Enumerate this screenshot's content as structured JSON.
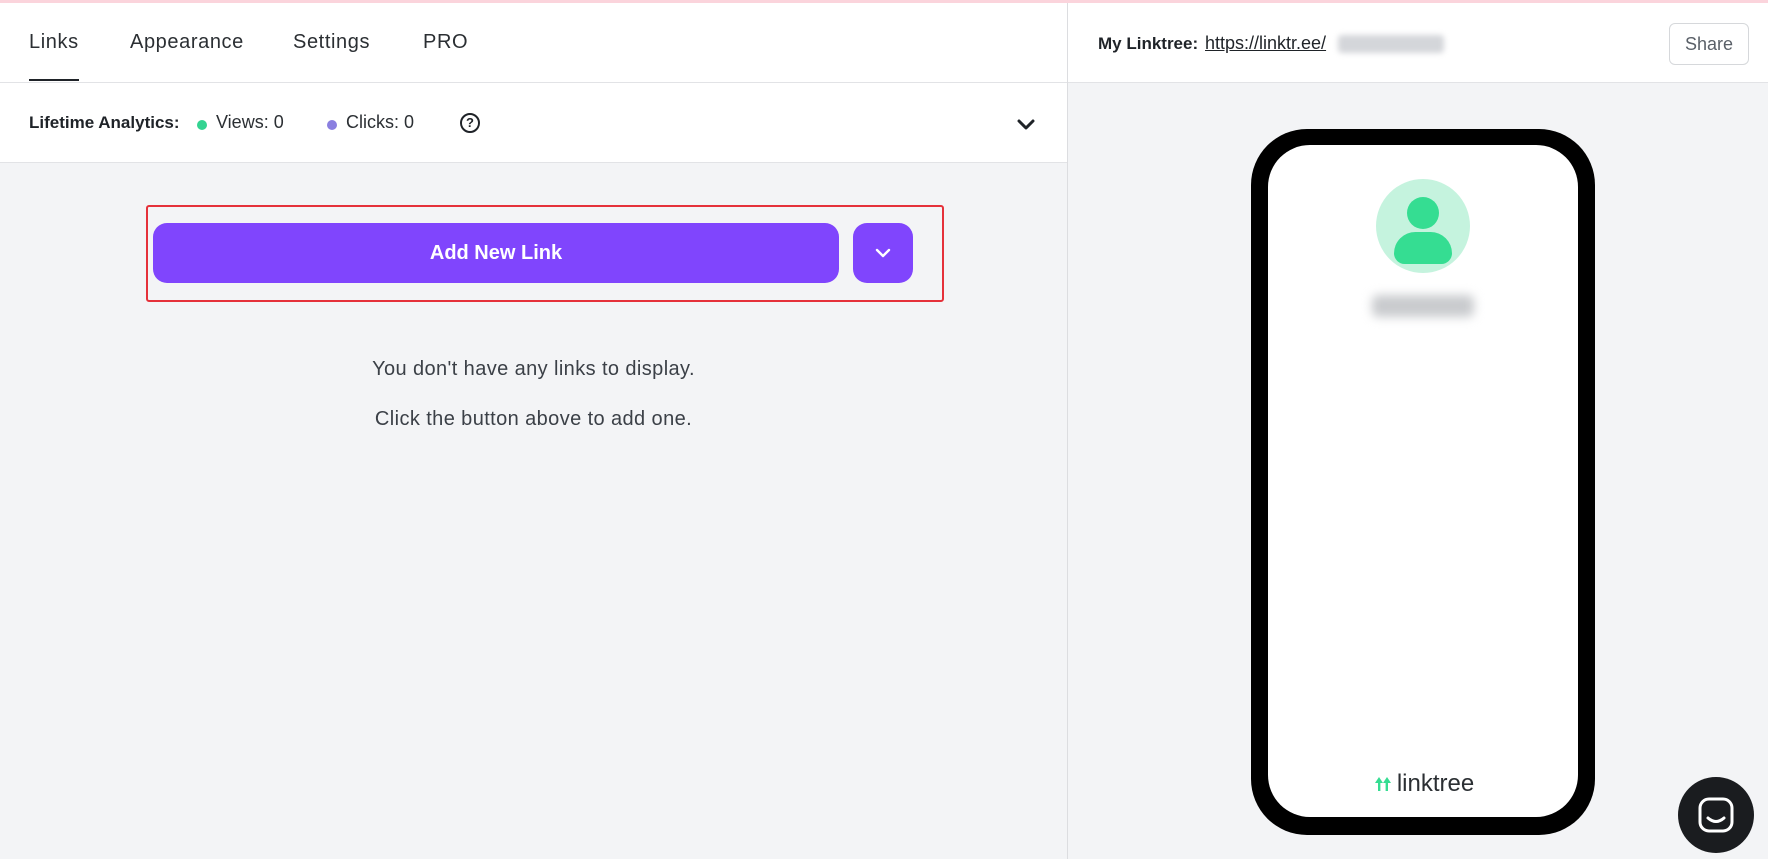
{
  "tabs": [
    {
      "label": "Links",
      "active": true
    },
    {
      "label": "Appearance",
      "active": false
    },
    {
      "label": "Settings",
      "active": false
    },
    {
      "label": "PRO",
      "active": false
    }
  ],
  "analytics": {
    "label": "Lifetime Analytics:",
    "views": "Views: 0",
    "clicks": "Clicks: 0",
    "views_color": "#33d391",
    "clicks_color": "#8a7fe0",
    "help_glyph": "?"
  },
  "actions": {
    "add_link_label": "Add New Link",
    "accent_color": "#8045fd"
  },
  "empty_state": {
    "line1": "You don't have any links to display.",
    "line2": "Click the button above to add one."
  },
  "preview": {
    "label": "My Linktree:",
    "url": "https://linktr.ee/",
    "share_label": "Share",
    "brand_name": "linktree",
    "brand_color": "#35dd92"
  },
  "icons": {
    "help": "help-circle-icon",
    "expand": "chevron-down-icon",
    "add_dropdown": "chevron-down-icon",
    "avatar": "user-avatar-icon",
    "brand": "linktree-logo-icon",
    "chat": "chat-bubble-icon"
  }
}
